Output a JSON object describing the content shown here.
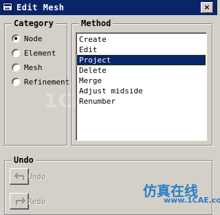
{
  "window": {
    "title": "Edit Mesh",
    "close_label": "×"
  },
  "category": {
    "label": "Category",
    "options": [
      {
        "label": "Node",
        "checked": true
      },
      {
        "label": "Element",
        "checked": false
      },
      {
        "label": "Mesh",
        "checked": false
      },
      {
        "label": "Refinement",
        "checked": false
      }
    ]
  },
  "method": {
    "label": "Method",
    "items": [
      "Create",
      "Edit",
      "Project",
      "Delete",
      "Merge",
      "Adjust midside",
      "Renumber"
    ],
    "selected": "Project"
  },
  "undo": {
    "label": "Undo",
    "undo_label": "Undo",
    "redo_label": "Redo"
  },
  "watermark": {
    "text": "1CAE.COM"
  },
  "branding": {
    "line1": "仿真在线",
    "line2": "www.1CAE.com"
  }
}
